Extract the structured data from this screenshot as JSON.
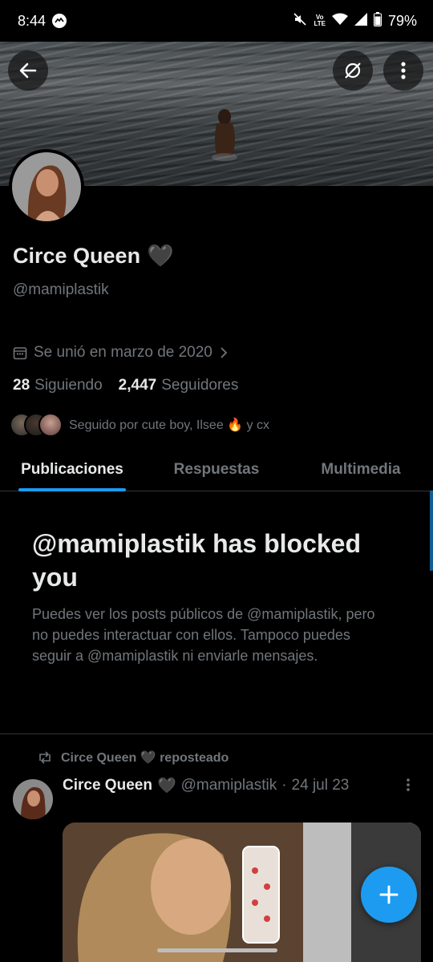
{
  "status_bar": {
    "time": "8:44",
    "battery": "79%",
    "network_label": "Vo LTE"
  },
  "profile": {
    "display_name": "Circe Queen",
    "name_emoji": "🖤",
    "handle": "@mamiplastik",
    "joined": "Se unió en marzo de 2020",
    "following_count": "28",
    "following_label": "Siguiendo",
    "followers_count": "2,447",
    "followers_label": "Seguidores",
    "followed_by": "Seguido por cute boy, Ilsee 🔥 y cx"
  },
  "tabs": [
    {
      "label": "Publicaciones",
      "active": true
    },
    {
      "label": "Respuestas",
      "active": false
    },
    {
      "label": "Multimedia",
      "active": false
    }
  ],
  "blocked": {
    "title": "@mamiplastik has blocked you",
    "description": "Puedes ver los posts públicos de @mamiplastik, pero no puedes interactuar con ellos. Tampoco puedes seguir a @mamiplastik ni enviarle mensajes."
  },
  "post": {
    "repost_label": "Circe Queen 🖤 reposteado",
    "author_name": "Circe Queen",
    "author_emoji": "🖤",
    "author_handle": "@mamiplastik",
    "separator": "·",
    "date": "24 jul 23"
  },
  "colors": {
    "accent": "#1d9bf0",
    "secondary_text": "#71767b",
    "primary_text": "#e7e9ea",
    "background": "#000000"
  }
}
